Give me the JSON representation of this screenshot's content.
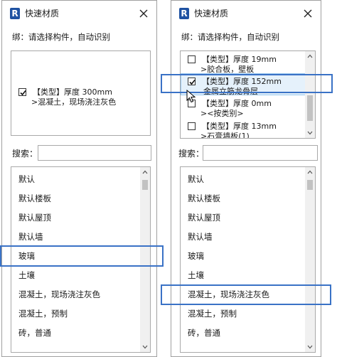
{
  "left": {
    "title": "快速材质",
    "bind_label": "绑：请选择构件，自动识别",
    "type_items": [
      {
        "name": "【类型】厚度 300mm",
        "material": ">混凝土，现场浇注灰色",
        "checked": true
      }
    ],
    "search_label": "搜索：",
    "search_value": "",
    "materials": [
      "默认",
      "默认楼板",
      "默认屋顶",
      "默认墙",
      "玻璃",
      "土壤",
      "混凝土，现场浇注灰色",
      "混凝土，预制",
      "砖，普通"
    ]
  },
  "right": {
    "title": "快速材质",
    "bind_label": "绑：请选择构件，自动识别",
    "type_items": [
      {
        "name": "【类型】厚度 19mm",
        "material": ">胶合板，壁板",
        "checked": false
      },
      {
        "name": "【类型】厚度 152mm",
        "material": "金属立筋龙骨层",
        "checked": true
      },
      {
        "name": "【类型】厚度 0mm",
        "material": "><按类别>",
        "checked": false
      },
      {
        "name": "【类型】厚度 13mm",
        "material": ">石膏墙板(1)",
        "checked": false
      }
    ],
    "search_label": "搜索：",
    "search_value": "",
    "materials": [
      "默认",
      "默认楼板",
      "默认屋顶",
      "默认墙",
      "玻璃",
      "土壤",
      "混凝土，现场浇注灰色",
      "混凝土，预制",
      "砖，普通"
    ]
  },
  "icons": {
    "app": "revit-logo-icon",
    "close": "close-icon",
    "check": "checkmark-icon",
    "cursor": "mouse-cursor-icon"
  },
  "colors": {
    "highlight": "#3a72c6",
    "brand": "#1f52a2",
    "selected_bg": "#e5f1fb"
  },
  "app_letter": "R"
}
